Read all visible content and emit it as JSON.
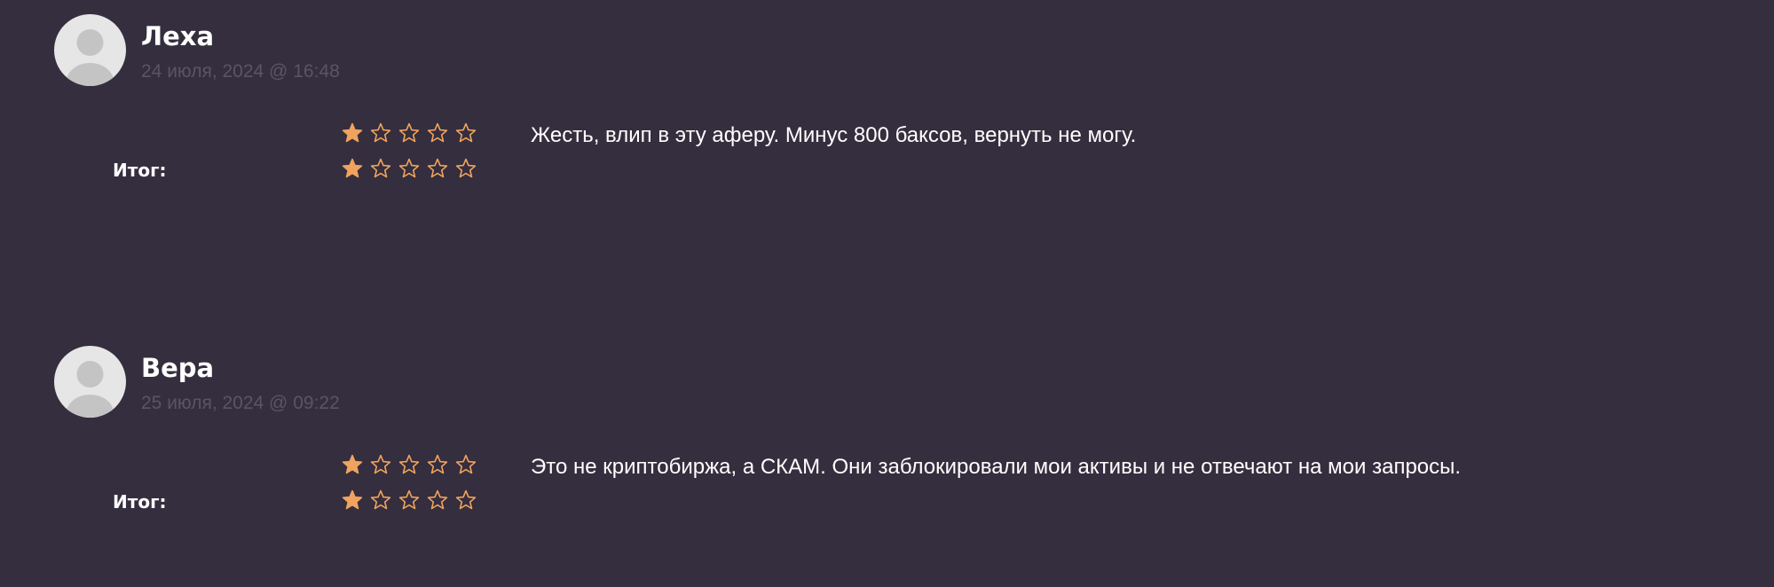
{
  "colors": {
    "background": "#352e3e",
    "star": "#f0a35e",
    "date_text": "#5a5464",
    "avatar_bg": "#e6e6e6",
    "avatar_fg": "#c4c4c4"
  },
  "reviews": [
    {
      "author": "Леха",
      "date": "24 июля, 2024 @ 16:48",
      "rating": 1,
      "rating_max": 5,
      "total_label": "Итог:",
      "total_rating": 1,
      "text": "Жесть, влип в эту аферу. Минус 800 баксов, вернуть не могу."
    },
    {
      "author": "Вера",
      "date": "25 июля, 2024 @ 09:22",
      "rating": 1,
      "rating_max": 5,
      "total_label": "Итог:",
      "total_rating": 1,
      "text": "Это не криптобиржа, а СКАМ. Они заблокировали мои активы и не отвечают на мои запросы."
    }
  ]
}
